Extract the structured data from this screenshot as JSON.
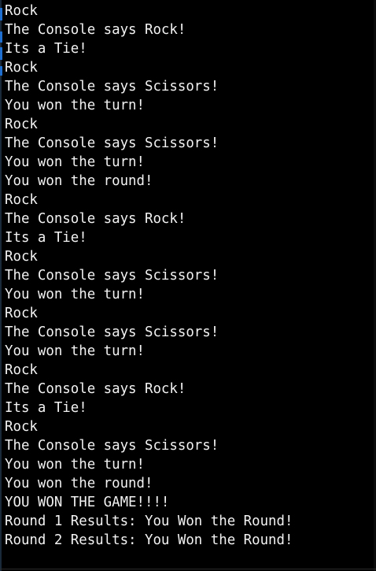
{
  "console": {
    "lines": [
      "Rock",
      "The Console says Rock!",
      "Its a Tie!",
      "Rock",
      "The Console says Scissors!",
      "You won the turn!",
      "Rock",
      "The Console says Scissors!",
      "You won the turn!",
      "You won the round!",
      "Rock",
      "The Console says Rock!",
      "Its a Tie!",
      "Rock",
      "The Console says Scissors!",
      "You won the turn!",
      "Rock",
      "The Console says Scissors!",
      "You won the turn!",
      "Rock",
      "The Console says Rock!",
      "Its a Tie!",
      "Rock",
      "The Console says Scissors!",
      "You won the turn!",
      "You won the round!",
      "YOU WON THE GAME!!!!",
      "Round 1 Results: You Won the Round!",
      "Round 2 Results: You Won the Round!"
    ]
  },
  "colors": {
    "background": "#000000",
    "text": "#f2f2f2",
    "edge_accent": "#1f6fd1"
  }
}
